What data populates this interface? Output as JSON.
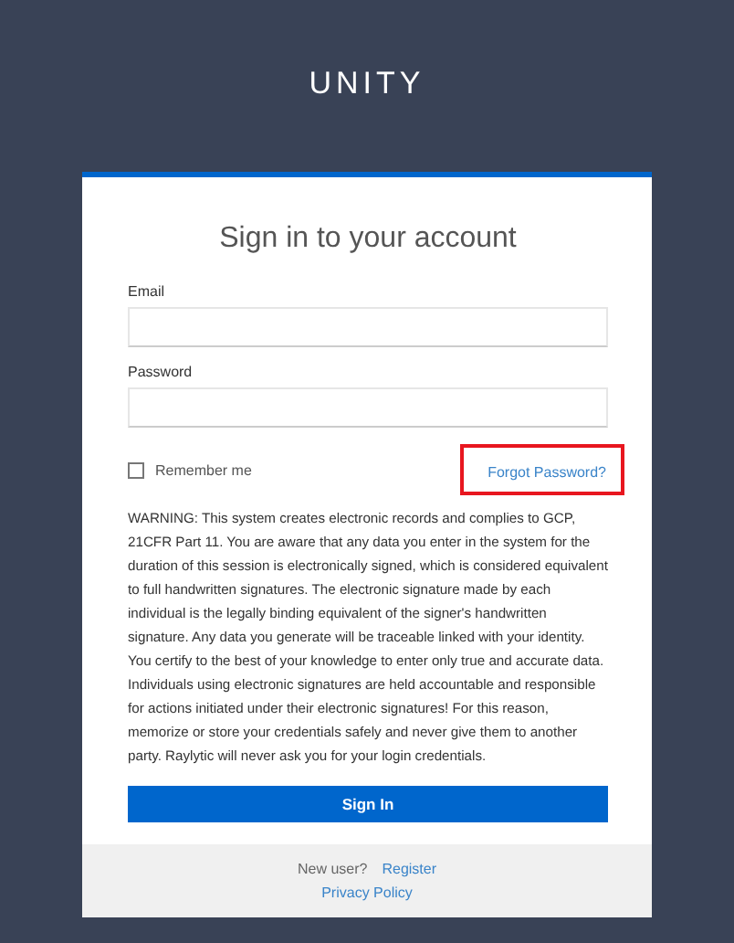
{
  "brand": "UNITY",
  "heading": "Sign in to your account",
  "fields": [
    {
      "label": "Email"
    },
    {
      "label": "Password"
    }
  ],
  "remember": {
    "label": "Remember me",
    "checked": false
  },
  "forgot": {
    "label": "Forgot Password?",
    "highlighted": true
  },
  "warning": "WARNING: This system creates electronic records and complies to GCP, 21CFR Part 11. You are aware that any data you enter in the system for the duration of this session is electronically signed, which is considered equivalent to full handwritten signatures. The electronic signature made by each individual is the legally binding equivalent of the signer's handwritten signature. Any data you generate will be traceable linked with your identity. You certify to the best of your knowledge to enter only true and accurate data. Individuals using electronic signatures are held accountable and responsible for actions initiated under their electronic signatures! For this reason, memorize or store your credentials safely and never give them to another party. Raylytic will never ask you for your login credentials.",
  "submit": "Sign In",
  "footer": {
    "prompt": "New user?",
    "register": "Register",
    "privacy": "Privacy Policy"
  }
}
